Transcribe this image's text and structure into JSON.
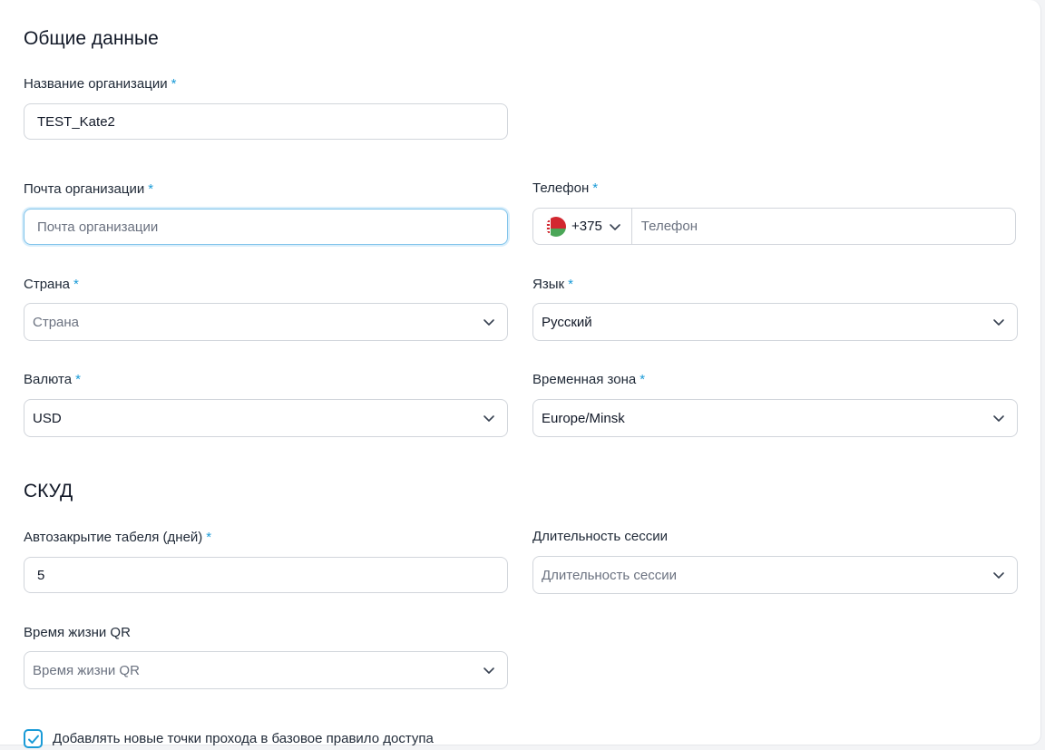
{
  "general": {
    "title": "Общие данные",
    "org_name": {
      "label": "Название организации",
      "required": "*",
      "value": "TEST_Kate2"
    },
    "org_email": {
      "label": "Почта организации",
      "required": "*",
      "placeholder": "Почта организации",
      "value": ""
    },
    "phone": {
      "label": "Телефон",
      "required": "*",
      "country_code": "+375",
      "placeholder": "Телефон",
      "flag_icon": "belarus-flag-icon"
    },
    "country": {
      "label": "Страна",
      "required": "*",
      "placeholder": "Страна",
      "value": ""
    },
    "language": {
      "label": "Язык",
      "required": "*",
      "value": "Русский"
    },
    "currency": {
      "label": "Валюта",
      "required": "*",
      "value": "USD"
    },
    "timezone": {
      "label": "Временная зона",
      "required": "*",
      "value": "Europe/Minsk"
    }
  },
  "skud": {
    "title": "СКУД",
    "autoclose": {
      "label": "Автозакрытие табеля (дней)",
      "required": "*",
      "value": "5"
    },
    "session": {
      "label": "Длительность сессии",
      "placeholder": "Длительность сессии",
      "value": ""
    },
    "qr_lifetime": {
      "label": "Время жизни QR",
      "placeholder": "Время жизни QR",
      "value": ""
    },
    "add_points": {
      "label": "Добавлять новые точки прохода в базовое правило доступа",
      "checked": true
    }
  },
  "colors": {
    "accent": "#1a9bd7",
    "border": "#d1d5db",
    "focus": "#7fc3ea"
  }
}
